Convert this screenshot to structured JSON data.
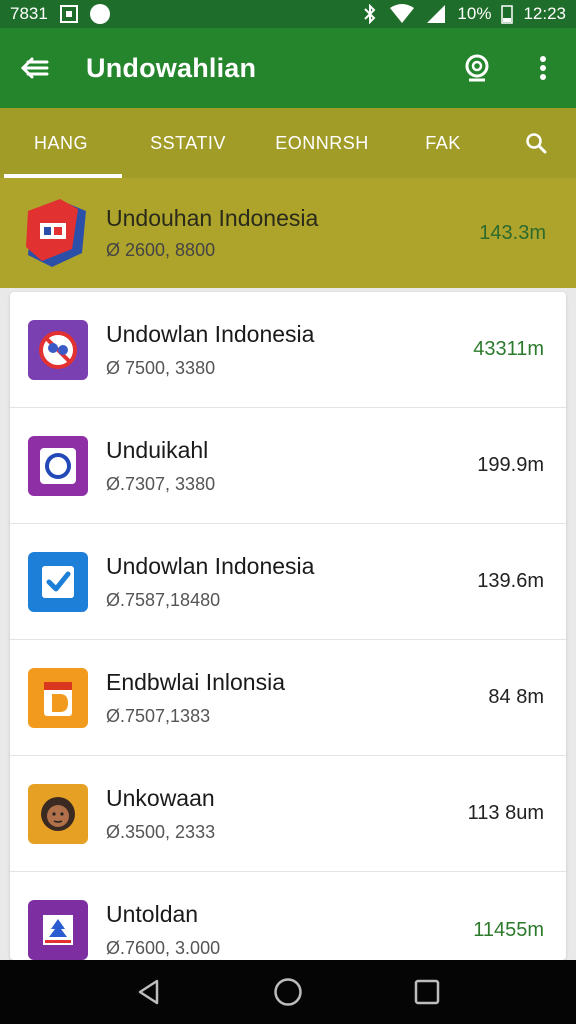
{
  "status_bar": {
    "left_text": "7831",
    "battery": "10%",
    "time": "12:23"
  },
  "app_bar": {
    "title": "Undowahlian"
  },
  "tabs": [
    {
      "label": "HANG",
      "active": true
    },
    {
      "label": "SSTATIV",
      "active": false
    },
    {
      "label": "EONNRSH",
      "active": false
    },
    {
      "label": "FAK",
      "active": false
    }
  ],
  "featured": {
    "name": "Undouhan Indonesia",
    "meta": "Ø 2600, 8800",
    "size": "143.3m"
  },
  "apps": [
    {
      "name": "Undowlan Indonesia",
      "meta": "Ø 7500, 3380",
      "size": "43311m",
      "size_color": "green",
      "icon": "blocked-link-icon",
      "icon_bg": "#7a3fb0"
    },
    {
      "name": "Unduikahl",
      "meta": "Ø.7307, 3380",
      "size": "199.9m",
      "size_color": "dark",
      "icon": "compass-icon",
      "icon_bg": "#8e2fa6"
    },
    {
      "name": "Undowlan Indonesia",
      "meta": "Ø.7587,18480",
      "size": "139.6m",
      "size_color": "dark",
      "icon": "checkbox-icon",
      "icon_bg": "#1e7fd8"
    },
    {
      "name": "Endbwlai Inlonsia",
      "meta": "Ø.7507,1383",
      "size": "84 8m",
      "size_color": "dark",
      "icon": "calendar-d-icon",
      "icon_bg": "#f29a1e"
    },
    {
      "name": "Unkowaan",
      "meta": "Ø.3500, 2333",
      "size": "113 8um",
      "size_color": "dark",
      "icon": "avatar-face-icon",
      "icon_bg": "#e6a124"
    },
    {
      "name": "Untoldan",
      "meta": "Ø.7600, 3.000",
      "size": "11455m",
      "size_color": "green",
      "icon": "tree-flag-icon",
      "icon_bg": "#7d2ea0"
    }
  ],
  "colors": {
    "status_bar": "#1f6d2a",
    "app_bar": "#24852d",
    "tabs_bg": "#a19b27",
    "featured_bg": "#aea42c",
    "green_text": "#2c7a2c"
  }
}
